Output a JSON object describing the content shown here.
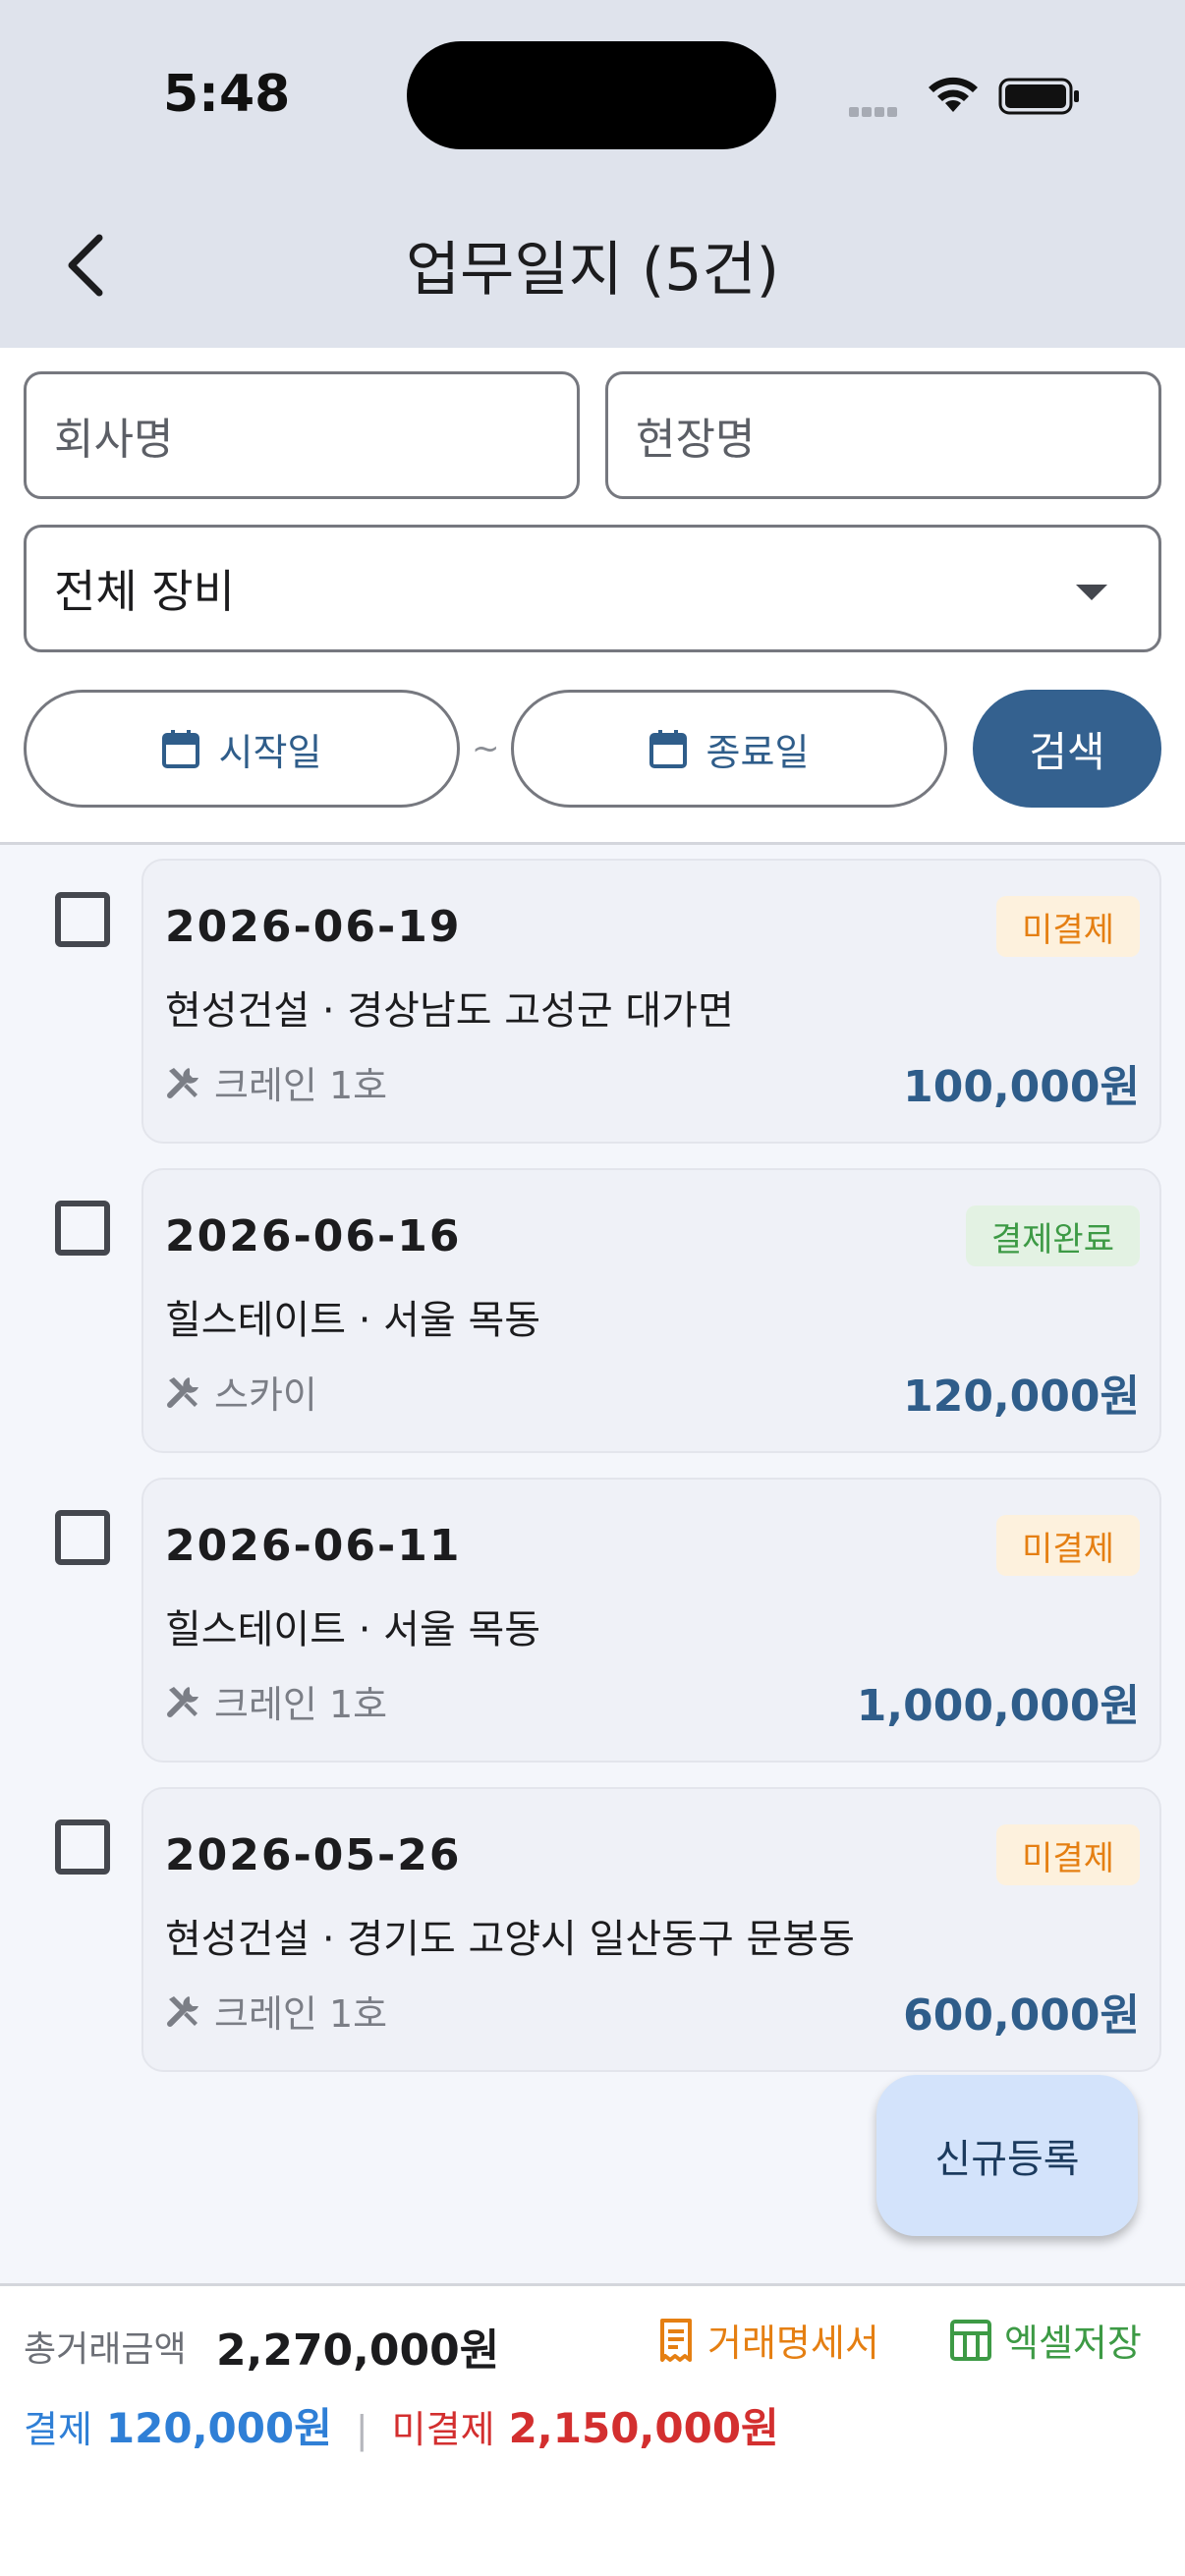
{
  "status_bar": {
    "time": "5:48"
  },
  "header": {
    "title": "업무일지 (5건)",
    "back_icon": "chevron-left-icon"
  },
  "filters": {
    "company_placeholder": "회사명",
    "site_placeholder": "현장명",
    "equipment_selected": "전체 장비",
    "start_date_label": "시작일",
    "range_separator": "~",
    "end_date_label": "종료일",
    "search_label": "검색"
  },
  "logs": [
    {
      "date": "2026-06-19",
      "status": "미결제",
      "status_type": "unpaid",
      "description": "현성건설 · 경상남도 고성군 대가면",
      "equipment": "크레인 1호",
      "amount": "100,000원",
      "checked": false
    },
    {
      "date": "2026-06-16",
      "status": "결제완료",
      "status_type": "paid",
      "description": "힐스테이트 · 서울 목동",
      "equipment": "스카이",
      "amount": "120,000원",
      "checked": false
    },
    {
      "date": "2026-06-11",
      "status": "미결제",
      "status_type": "unpaid",
      "description": "힐스테이트 · 서울 목동",
      "equipment": "크레인 1호",
      "amount": "1,000,000원",
      "checked": false
    },
    {
      "date": "2026-05-26",
      "status": "미결제",
      "status_type": "unpaid",
      "description": "현성건설 · 경기도 고양시 일산동구 문봉동",
      "equipment": "크레인 1호",
      "amount": "600,000원",
      "checked": false
    }
  ],
  "fab": {
    "label": "신규등록"
  },
  "footer": {
    "total_label": "총거래금액",
    "total_value": "2,270,000원",
    "statement_label": "거래명세서",
    "excel_label": "엑셀저장",
    "paid_label": "결제",
    "paid_value": "120,000원",
    "separator": "|",
    "unpaid_label": "미결제",
    "unpaid_value": "2,150,000원"
  },
  "colors": {
    "primary": "#34618f",
    "unpaid": "#e57f12",
    "paid": "#3d9a45",
    "paid_total": "#2f7fd6",
    "unpaid_total": "#d32f2f"
  }
}
